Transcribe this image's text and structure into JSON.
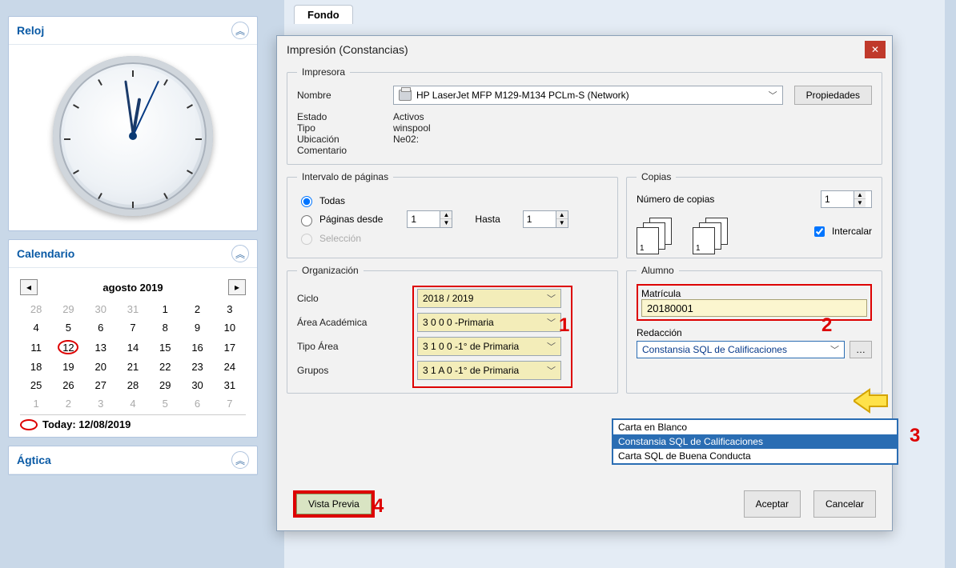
{
  "sidebar": {
    "reloj_title": "Reloj",
    "calendario_title": "Calendario",
    "agtica_title": "Ágtica",
    "month_label": "agosto 2019",
    "today_label": "Today: 12/08/2019",
    "today_day": "12",
    "weekdays": [
      "",
      "",
      "",
      "",
      "",
      "",
      ""
    ],
    "grid": [
      [
        "28",
        "29",
        "30",
        "31",
        "1",
        "2",
        "3"
      ],
      [
        "4",
        "5",
        "6",
        "7",
        "8",
        "9",
        "10"
      ],
      [
        "11",
        "12",
        "13",
        "14",
        "15",
        "16",
        "17"
      ],
      [
        "18",
        "19",
        "20",
        "21",
        "22",
        "23",
        "24"
      ],
      [
        "25",
        "26",
        "27",
        "28",
        "29",
        "30",
        "31"
      ],
      [
        "1",
        "2",
        "3",
        "4",
        "5",
        "6",
        "7"
      ]
    ]
  },
  "tabs": {
    "fondo": "Fondo"
  },
  "dialog": {
    "title": "Impresión (Constancias)",
    "impresora_legend": "Impresora",
    "nombre_label": "Nombre",
    "printer_name": "HP LaserJet MFP M129-M134 PCLm-S (Network)",
    "estado_label": "Estado",
    "estado_value": "Activos",
    "tipo_label": "Tipo",
    "tipo_value": "winspool",
    "ubicacion_label": "Ubicación",
    "ubicacion_value": "Ne02:",
    "comentario_label": "Comentario",
    "comentario_value": "",
    "propiedades_btn": "Propiedades",
    "intervalo_legend": "Intervalo de páginas",
    "todas_label": "Todas",
    "paginas_desde_label": "Páginas desde",
    "hasta_label": "Hasta",
    "desde_value": "1",
    "hasta_value": "1",
    "seleccion_label": "Selección",
    "copias_legend": "Copias",
    "numcopias_label": "Número de copias",
    "numcopias_value": "1",
    "intercalar_label": "Intercalar",
    "organizacion_legend": "Organización",
    "ciclo_label": "Ciclo",
    "ciclo_value": "2018 / 2019",
    "area_label": "Área Académica",
    "area_value": "3 0 0 0  -Primaria",
    "tipoarea_label": "Tipo Área",
    "tipoarea_value": "3 1 0 0  -1° de Primaria",
    "grupos_label": "Grupos",
    "grupos_value": "3 1 A 0  -1° de Primaria",
    "alumno_legend": "Alumno",
    "matricula_label": "Matrícula",
    "matricula_value": "20180001",
    "redaccion_label": "Redacción",
    "redaccion_value": "Constansia SQL de Calificaciones",
    "redaccion_options": [
      "Carta en Blanco",
      "Constansia SQL de Calificaciones",
      "Carta SQL de Buena Conducta"
    ],
    "vista_previa_btn": "Vista Previa",
    "aceptar_btn": "Aceptar",
    "cancelar_btn": "Cancelar"
  },
  "callouts": {
    "n1": "1",
    "n2": "2",
    "n3": "3",
    "n4": "4"
  }
}
